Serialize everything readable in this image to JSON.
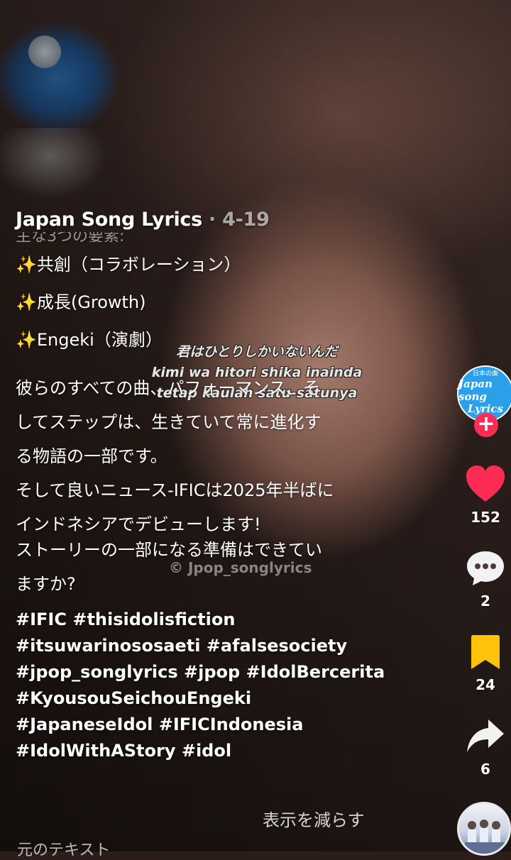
{
  "post": {
    "author": "Japan Song Lyrics",
    "date_separator": "·",
    "date": "4-19",
    "cut_line": "主な3つの要素:",
    "features": [
      {
        "emoji": "✨",
        "text": "共創（コラボレーション）"
      },
      {
        "emoji": "✨",
        "text": "成長(Growth)"
      },
      {
        "emoji": "✨",
        "text": "Engeki（演劇）"
      }
    ],
    "paragraph1": [
      "彼らのすべての曲、パフォーマンス、そ",
      "してステップは、生きていて常に進化す",
      "る物語の一部です。"
    ],
    "paragraph2": [
      "そして良いニュース-IFICは2025年半ばに",
      "インドネシアでデビューします!"
    ],
    "paragraph3": [
      "ストーリーの一部になる準備はできてい",
      "ますか?"
    ],
    "hashtag_lines": [
      "#IFIC #thisidolisfiction",
      "#itsuwarinososaeti #afalsesociety",
      "#jpop_songlyrics #jpop #IdolBercerita",
      "#KyousouSeichouEngeki",
      "#JapaneseIdol #IFICIndonesia",
      "#IdolWithAStory #idol"
    ],
    "show_less": "表示を減らす",
    "original_text": "元のテキスト"
  },
  "video_overlay": {
    "subtitle_lines": [
      "君はひとりしかいないんだ",
      "kimi wa hitori shika inainda",
      "tetap kaulah satu-satunya"
    ],
    "watermark": "© Jpop_songlyrics"
  },
  "rail": {
    "avatar_small": "日本の曲",
    "avatar_line1": "Japan song",
    "avatar_line2": "Lyrics",
    "follow_symbol": "+",
    "likes": "152",
    "comments": "2",
    "saves": "24",
    "shares": "6",
    "icons": [
      "heart-icon",
      "comment-icon",
      "bookmark-icon",
      "share-icon",
      "music-disc-icon"
    ]
  },
  "colors": {
    "like": "#fe2c55",
    "bookmark": "#fcc30a",
    "avatar_bg": "#2aa0ea",
    "avatar_text": "#ffffff",
    "follow": "#fe2c55"
  }
}
